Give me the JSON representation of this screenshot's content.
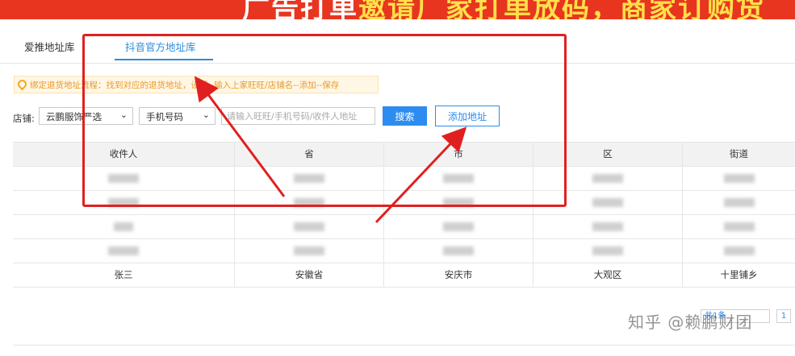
{
  "banner": {
    "text_white": "广告打单",
    "text_yellow": "邀请厂家打单放码，商家订购货"
  },
  "tabs": [
    {
      "label": "爱推地址库",
      "active": false
    },
    {
      "label": "抖音官方地址库",
      "active": true
    }
  ],
  "tip": {
    "icon": "location-pin-icon",
    "text": "绑定退货地址流程：找到对应的退货地址，设置--输入上家旺旺/店铺名--添加--保存"
  },
  "filters": {
    "store_label": "店铺:",
    "store_value": "云鹏服饰严选",
    "type_value": "手机号码",
    "search_placeholder": "请输入旺旺/手机号码/收件人地址",
    "search_button": "搜索",
    "add_button": "添加地址"
  },
  "table": {
    "columns": [
      "收件人",
      "省",
      "市",
      "区",
      "街道"
    ],
    "rows": [
      [
        "张三",
        "安徽省",
        "安庆市",
        "大观区",
        "十里铺乡"
      ]
    ]
  },
  "pager": {
    "label": "共1条",
    "page": "1"
  },
  "watermark": "知乎 @赖鹏财团",
  "colors": {
    "accent": "#2d8cf0",
    "annotation": "#e02020",
    "banner": "#e8351f"
  }
}
